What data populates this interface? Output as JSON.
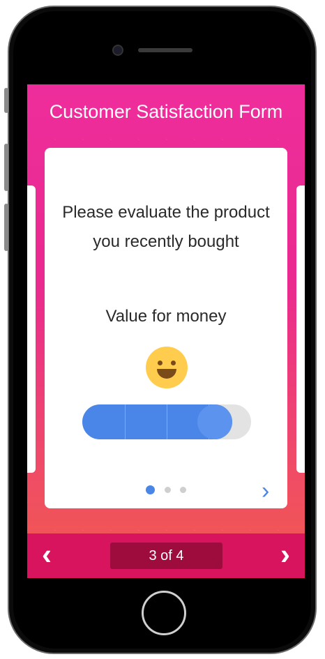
{
  "form": {
    "title": "Customer Satisfaction Form",
    "question": "Please evaluate the product you recently bought",
    "criterion": "Value for money",
    "rating_fraction": 0.86,
    "rating_face": "smiley-face-icon",
    "card_pagination": {
      "current": 1,
      "total": 3
    },
    "card_next_icon": "chevron-right-icon"
  },
  "footer": {
    "prev_icon": "chevron-left-icon",
    "next_icon": "chevron-right-icon",
    "counter": "3 of 4"
  },
  "colors": {
    "gradient_top": "#ee2d9c",
    "gradient_bottom": "#f25a4d",
    "footer_bar": "#d9145e",
    "counter_bg": "#9d0c3d",
    "accent_blue": "#4a86e8",
    "emoji_yellow": "#ffcc4d"
  }
}
